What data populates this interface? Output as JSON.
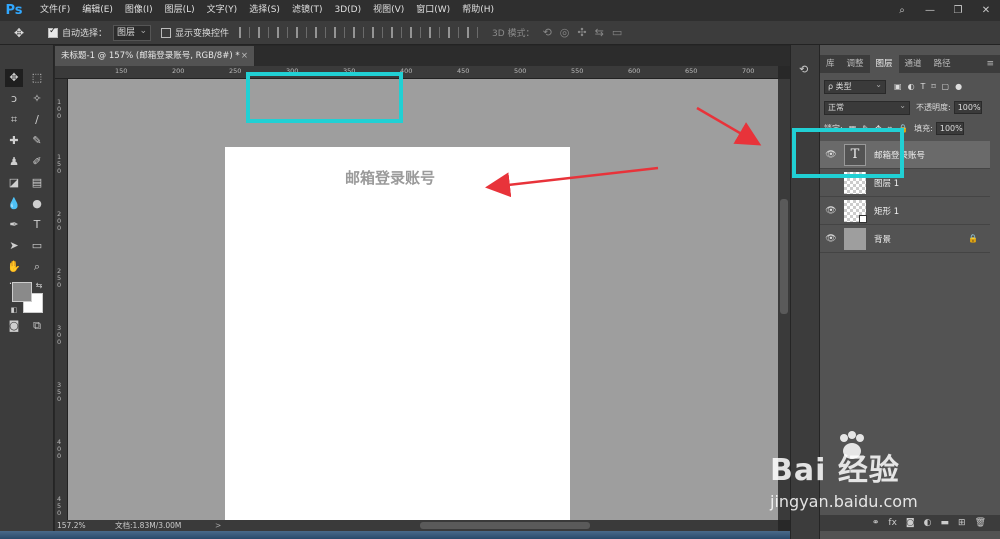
{
  "app": {
    "logo": "Ps"
  },
  "menu": [
    "文件(F)",
    "编辑(E)",
    "图像(I)",
    "图层(L)",
    "文字(Y)",
    "选择(S)",
    "滤镜(T)",
    "3D(D)",
    "视图(V)",
    "窗口(W)",
    "帮助(H)"
  ],
  "window_controls": {
    "minimize": "—",
    "restore": "❐",
    "close": "✕"
  },
  "options": {
    "auto_select_label": "自动选择：",
    "auto_select_value": "图层",
    "show_transform_label": "显示变换控件",
    "mode_3d_label": "3D 模式："
  },
  "document_tab": {
    "title": "未标题-1 @ 157% (邮箱登录账号, RGB/8#) *",
    "close": "×"
  },
  "ruler_top": [
    "150",
    "200",
    "250",
    "300",
    "350",
    "400",
    "450",
    "500",
    "550",
    "600",
    "650",
    "700"
  ],
  "ruler_left": [
    "1 0 0",
    "1 5 0",
    "2 0 0",
    "2 5 0",
    "3 0 0",
    "3 5 0",
    "4 0 0",
    "4 5 0"
  ],
  "canvas": {
    "text": "邮箱登录账号"
  },
  "status": {
    "zoom": "157.2%",
    "doc": "文档:1.83M/3.00M",
    "arrow": ">"
  },
  "panel": {
    "tabs": [
      "库",
      "调整",
      "图层",
      "通道",
      "路径"
    ],
    "active_tab": "图层",
    "filter_kind": "ρ 类型",
    "blend_mode": "正常",
    "opacity_label": "不透明度:",
    "opacity_value": "100%",
    "lock_label": "锁定:",
    "fill_label": "填充:",
    "fill_value": "100%",
    "layers": [
      {
        "name": "邮箱登录账号",
        "thumb": "T",
        "visible": true,
        "selected": true
      },
      {
        "name": "图层 1",
        "visible": false
      },
      {
        "name": "矩形 1",
        "visible": true
      },
      {
        "name": "背景",
        "visible": true,
        "locked": true
      }
    ]
  },
  "watermark": {
    "brand": "Bai 经验",
    "url": "jingyan.baidu.com"
  },
  "colors": {
    "highlight": "#21d0d4",
    "arrow": "#e8333a",
    "ps_blue": "#31a8ff"
  }
}
